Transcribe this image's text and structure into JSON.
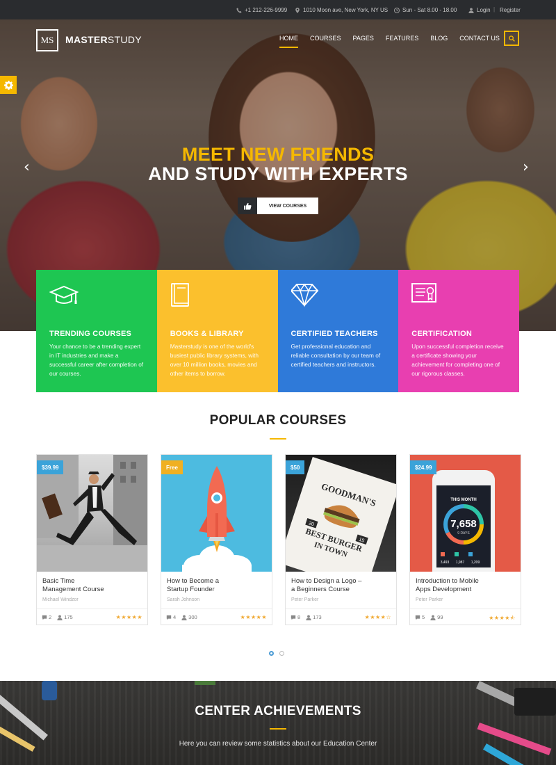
{
  "topbar": {
    "phone": "+1 212-226-9999",
    "address": "1010 Moon ave, New York, NY US",
    "hours": "Sun - Sat 8.00 - 18.00",
    "login": "Login",
    "separator": "|",
    "register": "Register"
  },
  "brand": {
    "logo_mark": "MS",
    "name_bold": "MASTER",
    "name_light": "STUDY"
  },
  "nav": {
    "items": [
      "HOME",
      "COURSES",
      "PAGES",
      "FEATURES",
      "BLOG",
      "CONTACT US"
    ],
    "active_index": 0
  },
  "hero": {
    "headline_1": "MEET NEW FRIENDS",
    "headline_2": "AND STUDY WITH EXPERTS",
    "cta_label": "VIEW COURSES",
    "prev_arrow": "‹",
    "next_arrow": "›"
  },
  "features": [
    {
      "icon": "graduation-cap-icon",
      "title": "TRENDING COURSES",
      "text": "Your chance to be a trending expert in IT industries and make a successful career after completion of our courses.",
      "color": "#1ec652"
    },
    {
      "icon": "book-icon",
      "title": "BOOKS & LIBRARY",
      "text": "Masterstudy is one of the world's busiest public library systems, with over 10 million books, movies and other items to borrow.",
      "color": "#fbc02d"
    },
    {
      "icon": "diamond-icon",
      "title": "CERTIFIED TEACHERS",
      "text": "Get professional education and reliable consultation by our team of certified teachers and instructors.",
      "color": "#2f7ad9"
    },
    {
      "icon": "certificate-icon",
      "title": "CERTIFICATION",
      "text": "Upon successful completion receive a certificate showing your achievement for completing one of our rigorous classes.",
      "color": "#e83fb0"
    }
  ],
  "popular": {
    "title": "POPULAR COURSES",
    "courses": [
      {
        "price": "$39.99",
        "price_color": "#3ba3d9",
        "title_line1": "Basic Time",
        "title_line2": "Management Course",
        "author": "Michael Windzor",
        "comments": "2",
        "students": "175",
        "rating": 5
      },
      {
        "price": "Free",
        "price_color": "#f0b022",
        "title_line1": "How to Become a",
        "title_line2": "Startup Founder",
        "author": "Sarah Johnson",
        "comments": "4",
        "students": "300",
        "rating": 5
      },
      {
        "price": "$50",
        "price_color": "#3ba3d9",
        "title_line1": "How to Design a Logo –",
        "title_line2": "a Beginners Course",
        "author": "Peter Parker",
        "comments": "8",
        "students": "173",
        "rating": 4
      },
      {
        "price": "$24.99",
        "price_color": "#3ba3d9",
        "title_line1": "Introduction to Mobile",
        "title_line2": "Apps Development",
        "author": "Peter Parker",
        "comments": "5",
        "students": "99",
        "rating": 4.5
      }
    ],
    "card_images": {
      "logo_text_top": "GOODMAN'S",
      "logo_text_left": "20",
      "logo_text_right": "15",
      "logo_text_bottom_1": "BEST BURGER",
      "logo_text_bottom_2": "IN TOWN",
      "phone_header": "THIS MONTH",
      "phone_value": "7,658",
      "phone_sub": "9 DAYS",
      "phone_stat_1": "3,493",
      "phone_stat_2": "1,987",
      "phone_stat_3": "1,209"
    }
  },
  "achievements": {
    "title": "CENTER ACHIEVEMENTS",
    "subtitle": "Here you can review some statistics about our Education Center"
  },
  "colors": {
    "accent": "#f5b800",
    "topbar_bg": "#2a2c2f"
  }
}
